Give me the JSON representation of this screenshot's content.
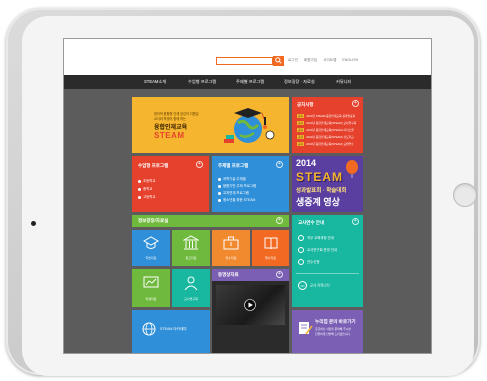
{
  "header": {
    "search_placeholder": "",
    "links": [
      "로그인",
      "회원가입",
      "사이트맵",
      "ENGLISH"
    ]
  },
  "nav": {
    "items": [
      "STEAM소개",
      "수업형 프로그램",
      "주제별 프로그램",
      "정보광장 · 자료실",
      "커뮤니티"
    ]
  },
  "banner": {
    "subtitle_line1": "창의적 융합형 인재 양성의 지름길",
    "subtitle_line2": "교사와 학생이 함께 하는",
    "title": "융합인재교육",
    "brand": "STEAM"
  },
  "notice": {
    "title": "공지사항",
    "items": [
      "2014년 STEAM 융합인재교육 성과발표회",
      "2014년 융합인재교육(STEAM) 교사연구회",
      "2014년 융합인재교육(STEAM) 리더스쿨",
      "2014년 융합인재교육(STEAM) 선도학교",
      "2014년 융합인재교육(STEAM) 교원연수"
    ],
    "badge": "공지"
  },
  "class_program": {
    "title": "수업형 프로그램",
    "items": [
      "초등학교",
      "중학교",
      "고등학교"
    ]
  },
  "topic_program": {
    "title": "주제별 프로그램",
    "items": [
      "과학기술 주제별",
      "융합기반 주제 프로그램",
      "교과연계 프로그램",
      "청소년을 위한 STEAM"
    ]
  },
  "promo": {
    "year": "2014",
    "brand": "STEAM",
    "line1": "성과발표회 · 학술대회",
    "line2": "생중계 영상"
  },
  "info": {
    "title": "정보광장/자료실",
    "tiles": [
      "학습자료",
      "참고자료",
      "연수자료",
      "행사자료",
      "학생자료",
      "교사연구회",
      "교과서"
    ]
  },
  "teacher": {
    "title": "교사연수 안내",
    "items": [
      "직무 교육과정 안내",
      "교사연구회 운영 안내",
      "연수신청",
      "교사 커뮤니티"
    ]
  },
  "video": {
    "title": "동영상자료"
  },
  "steam_academy": {
    "label": "STEAM 아카데미"
  },
  "inquiry": {
    "title": "누리집 문의 바로가기",
    "desc_line1": "궁금하신 사항을 문의해 주시면",
    "desc_line2": "친절하게 답변해 드리겠습니다."
  },
  "colors": {
    "accent_orange": "#f26a22",
    "yellow": "#f5b52e",
    "red": "#e6412c",
    "blue": "#2f8fd8",
    "green": "#6fba3c",
    "teal": "#18b7a0",
    "purple": "#7b5fb5",
    "orange": "#f18a2f"
  }
}
